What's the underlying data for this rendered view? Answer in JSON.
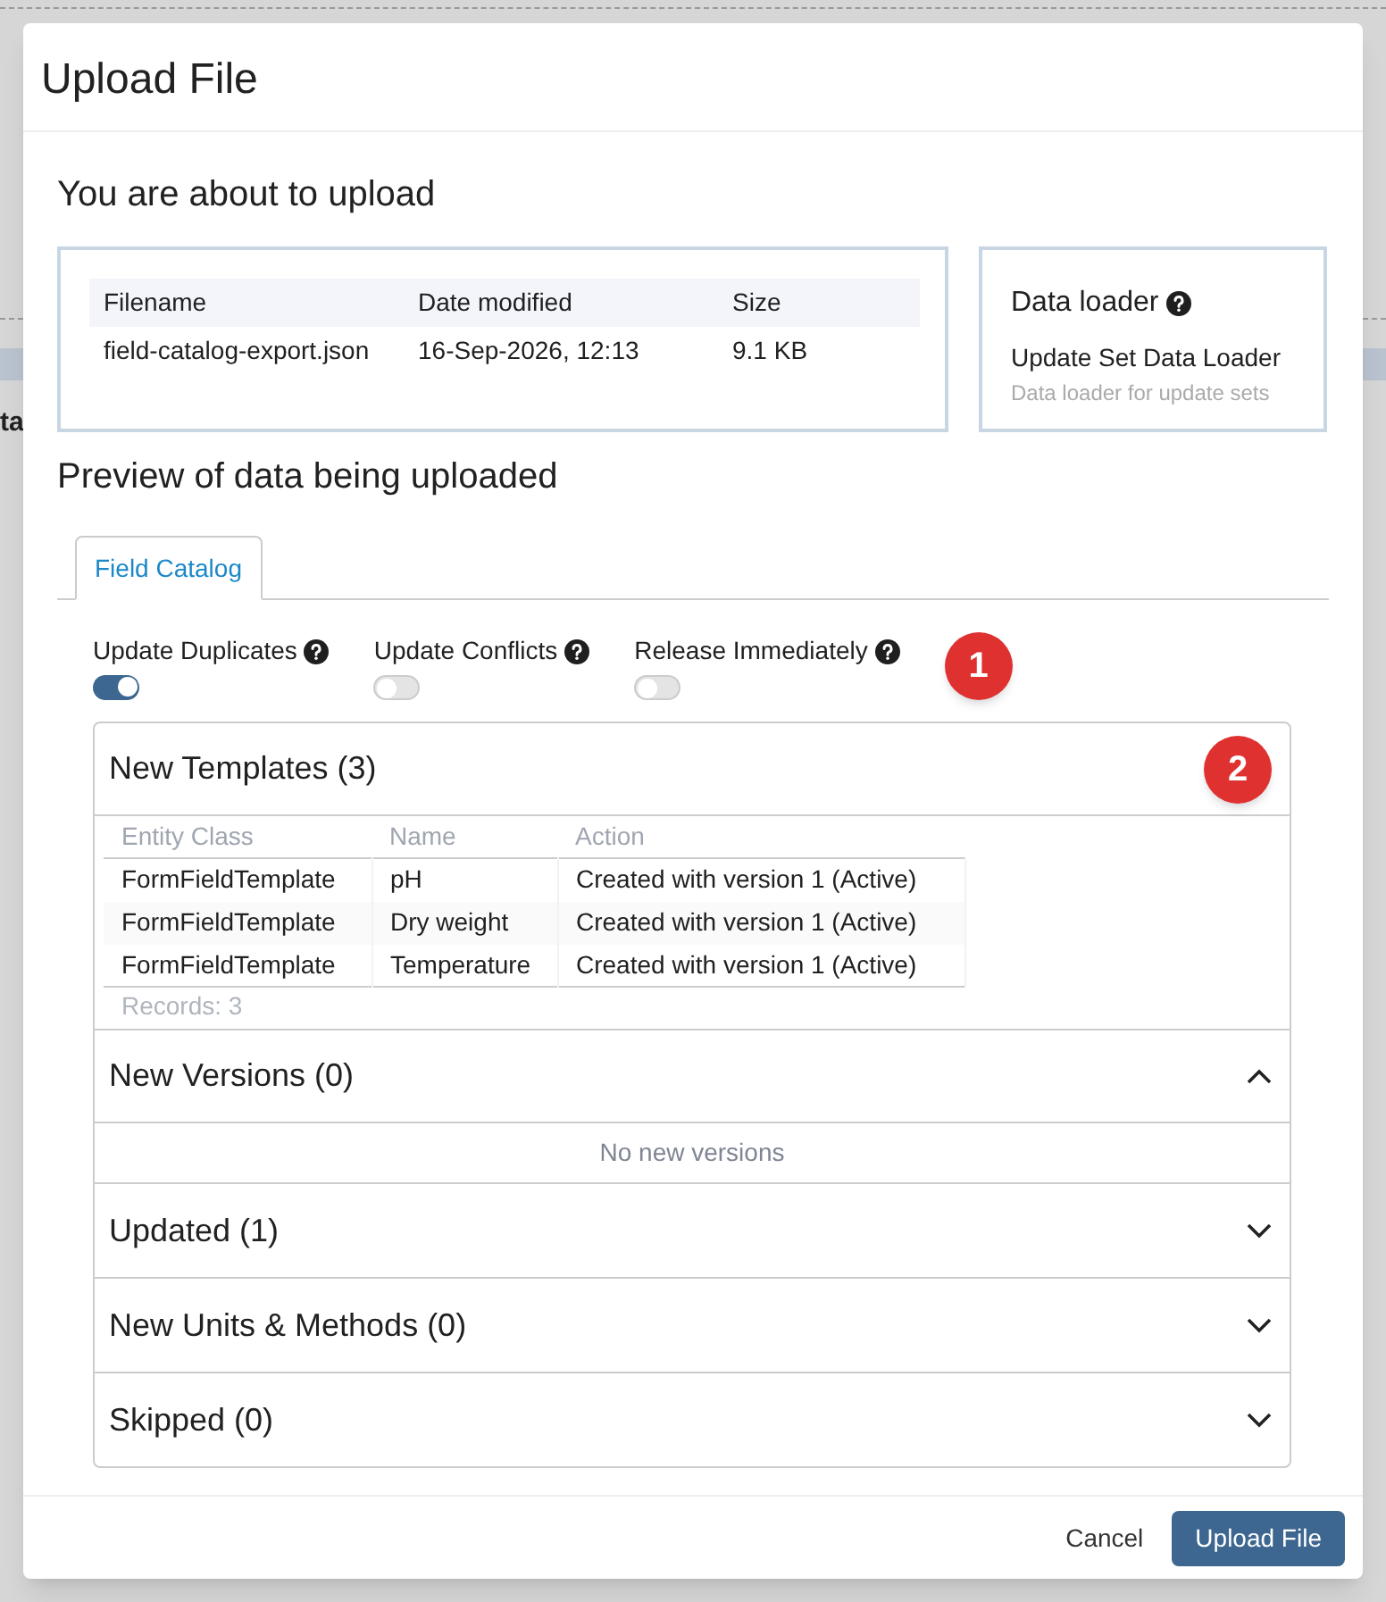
{
  "background": {
    "text": "ta"
  },
  "dialog": {
    "title": "Upload File",
    "upload_heading": "You are about to upload",
    "file_table": {
      "columns": [
        "Filename",
        "Date modified",
        "Size"
      ],
      "rows": [
        [
          "field-catalog-export.json",
          "16-Sep-2026, 12:13",
          "9.1 KB"
        ]
      ]
    },
    "loader": {
      "title": "Data loader",
      "name": "Update Set Data Loader",
      "description": "Data loader for update sets"
    },
    "preview_heading": "Preview of data being uploaded",
    "tabs": [
      {
        "label": "Field Catalog",
        "selected": true
      }
    ],
    "toggles": [
      {
        "label": "Update Duplicates",
        "on": true
      },
      {
        "label": "Update Conflicts",
        "on": false
      },
      {
        "label": "Release Immediately",
        "on": false
      }
    ],
    "toggle_annotation": "1",
    "sections": [
      {
        "title": "New Templates (3)",
        "expanded": true,
        "annotation": "2",
        "kind": "table",
        "columns": [
          "Entity Class",
          "Name",
          "Action"
        ],
        "rows": [
          [
            "FormFieldTemplate",
            "pH",
            "Created with version 1 (Active)"
          ],
          [
            "FormFieldTemplate",
            "Dry weight",
            "Created with version 1 (Active)"
          ],
          [
            "FormFieldTemplate",
            "Temperature",
            "Created with version 1 (Active)"
          ]
        ],
        "footer": "Records: 3"
      },
      {
        "title": "New Versions (0)",
        "expanded": true,
        "kind": "empty",
        "message": "No new versions"
      },
      {
        "title": "Updated (1)",
        "expanded": false
      },
      {
        "title": "New Units & Methods (0)",
        "expanded": false
      },
      {
        "title": "Skipped (0)",
        "expanded": false
      }
    ],
    "buttons": [
      {
        "label": "Cancel",
        "kind": "secondary"
      },
      {
        "label": "Upload File",
        "kind": "primary"
      }
    ]
  }
}
